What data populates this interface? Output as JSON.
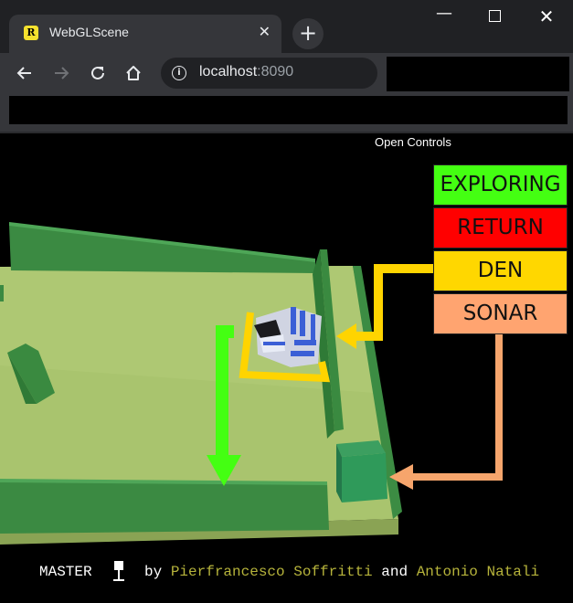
{
  "browser": {
    "tab_title": "WebGLScene",
    "favicon_letter": "R",
    "tab_close": "✕",
    "new_tab": "+",
    "window_minimize": "—",
    "window_close": "✕",
    "url_host": "localhost",
    "url_port": ":8090",
    "info_icon": "i"
  },
  "page": {
    "open_controls": "Open Controls"
  },
  "legend": [
    {
      "label": "EXPLORING",
      "color": "#44ff12"
    },
    {
      "label": "RETURN",
      "color": "#ff0000"
    },
    {
      "label": "DEN",
      "color": "#ffd700"
    },
    {
      "label": "SONAR",
      "color": "#ffa470"
    }
  ],
  "footer": {
    "master": "MASTER",
    "by": "by",
    "author1": "Pierfrancesco Soffritti",
    "and": "and",
    "author2": "Antonio Natali"
  },
  "colors": {
    "floor": "#a6c26b",
    "wall": "#3f8a45",
    "den_arrow": "#ffd400",
    "exploring_arrow": "#44ff12",
    "sonar_arrow": "#f6a56c",
    "author": "#b6b33b"
  }
}
